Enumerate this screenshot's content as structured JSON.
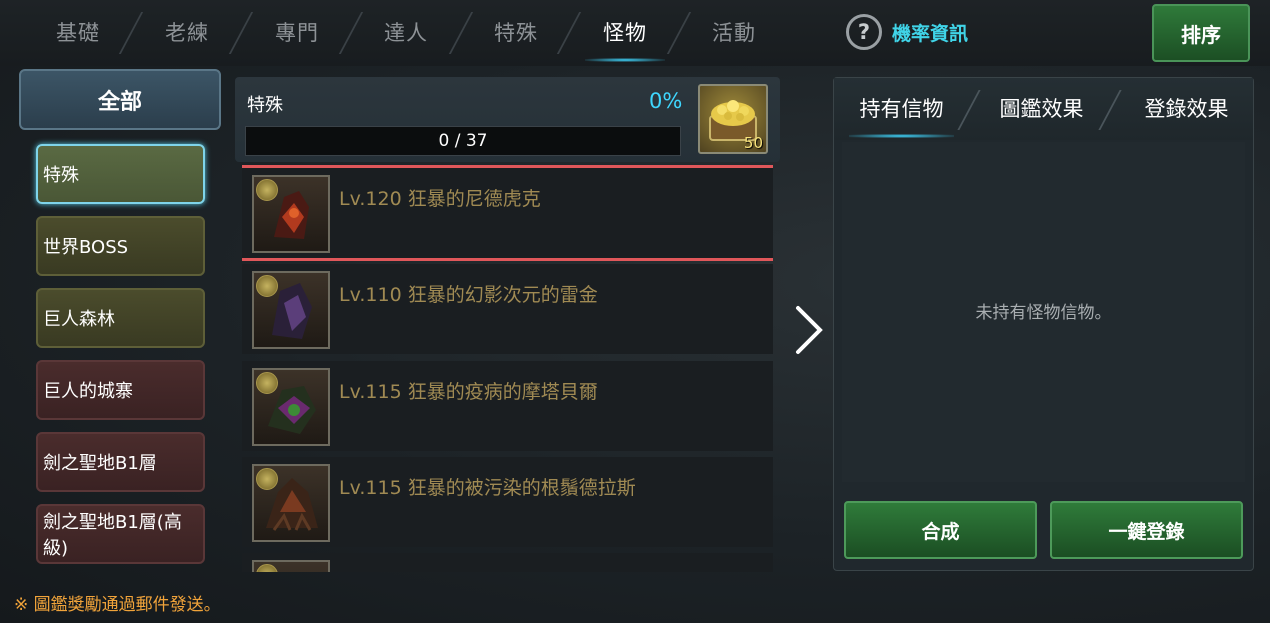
{
  "top_tabs": [
    {
      "label": "基礎"
    },
    {
      "label": "老練"
    },
    {
      "label": "專門"
    },
    {
      "label": "達人"
    },
    {
      "label": "特殊"
    },
    {
      "label": "怪物",
      "active": true
    },
    {
      "label": "活動"
    }
  ],
  "help": {
    "icon": "question-icon",
    "label": "機率資訊"
  },
  "sort_button": "排序",
  "categories": {
    "all_label": "全部",
    "items": [
      {
        "label": "特殊",
        "style": "active"
      },
      {
        "label": "世界BOSS",
        "style": "olive"
      },
      {
        "label": "巨人森林",
        "style": "olive"
      },
      {
        "label": "巨人的城寨",
        "style": "red"
      },
      {
        "label": "劍之聖地B1層",
        "style": "red"
      },
      {
        "label": "劍之聖地B1層(高級)",
        "style": "red"
      }
    ]
  },
  "progress": {
    "title": "特殊",
    "percent": "0%",
    "count": "0 / 37",
    "reward_count": "50",
    "reward_icon": "gold-chest-icon"
  },
  "monsters": [
    {
      "name": "Lv.120 狂暴的尼德虎克",
      "selected": true,
      "icon": "monster-portrait-icon"
    },
    {
      "name": "Lv.110 狂暴的幻影次元的雷金",
      "icon": "monster-portrait-icon"
    },
    {
      "name": "Lv.115 狂暴的疫病的摩塔貝爾",
      "icon": "monster-portrait-icon"
    },
    {
      "name": "Lv.115 狂暴的被污染的根鬚德拉斯",
      "icon": "monster-portrait-icon"
    }
  ],
  "right_panel": {
    "tabs": [
      {
        "label": "持有信物",
        "active": true
      },
      {
        "label": "圖鑑效果"
      },
      {
        "label": "登錄效果"
      }
    ],
    "empty_message": "未持有怪物信物。",
    "combine_button": "合成",
    "register_all_button": "一鍵登錄"
  },
  "footer_note": "※ 圖鑑獎勵通過郵件發送。",
  "colors": {
    "accent_cyan": "#3fd7ff",
    "monster_name": "#a08a53",
    "note_orange": "#f0a33a",
    "button_green": "#2f7b3a",
    "selection_red": "#e0575a"
  }
}
